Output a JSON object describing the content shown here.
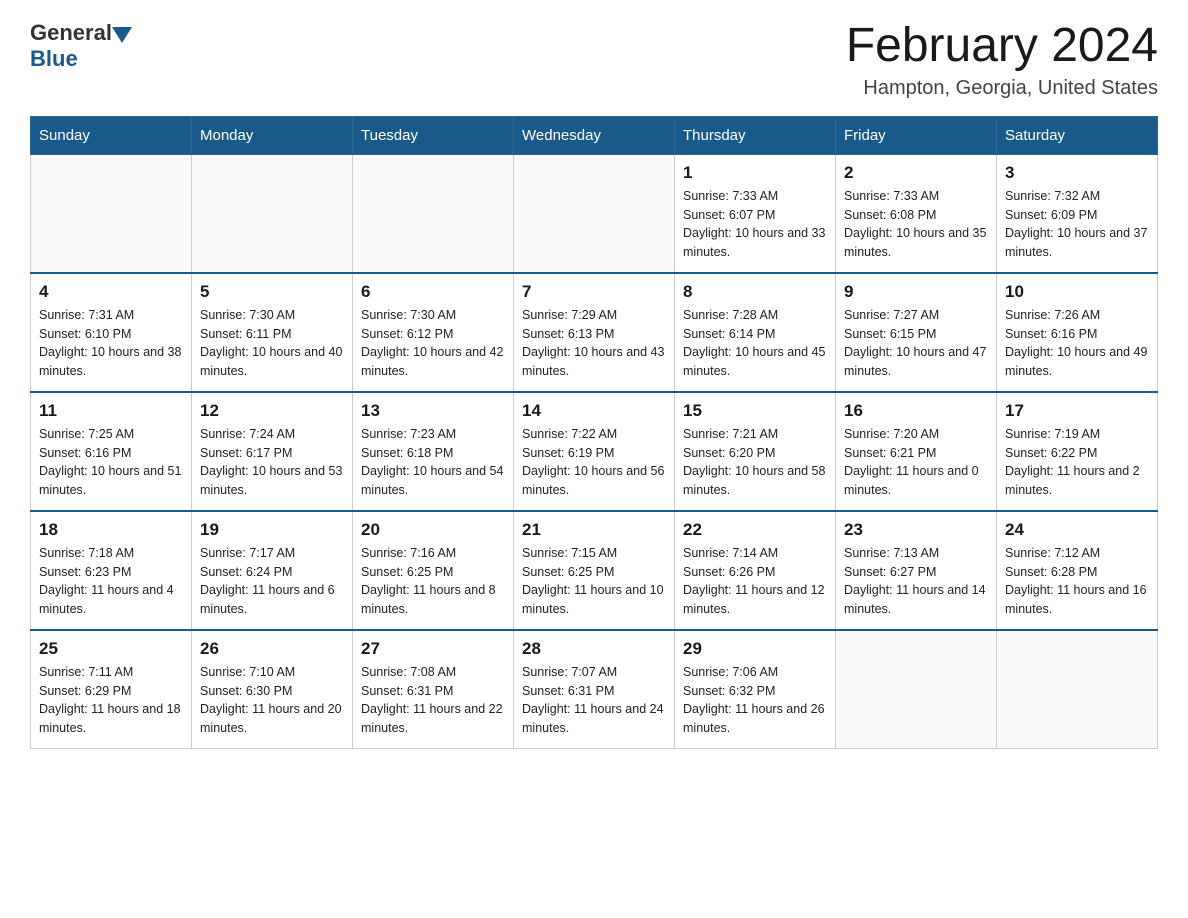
{
  "logo": {
    "text_general": "General",
    "text_blue": "Blue"
  },
  "header": {
    "month_title": "February 2024",
    "location": "Hampton, Georgia, United States"
  },
  "days_of_week": [
    "Sunday",
    "Monday",
    "Tuesday",
    "Wednesday",
    "Thursday",
    "Friday",
    "Saturday"
  ],
  "weeks": [
    [
      {
        "day": "",
        "info": ""
      },
      {
        "day": "",
        "info": ""
      },
      {
        "day": "",
        "info": ""
      },
      {
        "day": "",
        "info": ""
      },
      {
        "day": "1",
        "info": "Sunrise: 7:33 AM\nSunset: 6:07 PM\nDaylight: 10 hours and 33 minutes."
      },
      {
        "day": "2",
        "info": "Sunrise: 7:33 AM\nSunset: 6:08 PM\nDaylight: 10 hours and 35 minutes."
      },
      {
        "day": "3",
        "info": "Sunrise: 7:32 AM\nSunset: 6:09 PM\nDaylight: 10 hours and 37 minutes."
      }
    ],
    [
      {
        "day": "4",
        "info": "Sunrise: 7:31 AM\nSunset: 6:10 PM\nDaylight: 10 hours and 38 minutes."
      },
      {
        "day": "5",
        "info": "Sunrise: 7:30 AM\nSunset: 6:11 PM\nDaylight: 10 hours and 40 minutes."
      },
      {
        "day": "6",
        "info": "Sunrise: 7:30 AM\nSunset: 6:12 PM\nDaylight: 10 hours and 42 minutes."
      },
      {
        "day": "7",
        "info": "Sunrise: 7:29 AM\nSunset: 6:13 PM\nDaylight: 10 hours and 43 minutes."
      },
      {
        "day": "8",
        "info": "Sunrise: 7:28 AM\nSunset: 6:14 PM\nDaylight: 10 hours and 45 minutes."
      },
      {
        "day": "9",
        "info": "Sunrise: 7:27 AM\nSunset: 6:15 PM\nDaylight: 10 hours and 47 minutes."
      },
      {
        "day": "10",
        "info": "Sunrise: 7:26 AM\nSunset: 6:16 PM\nDaylight: 10 hours and 49 minutes."
      }
    ],
    [
      {
        "day": "11",
        "info": "Sunrise: 7:25 AM\nSunset: 6:16 PM\nDaylight: 10 hours and 51 minutes."
      },
      {
        "day": "12",
        "info": "Sunrise: 7:24 AM\nSunset: 6:17 PM\nDaylight: 10 hours and 53 minutes."
      },
      {
        "day": "13",
        "info": "Sunrise: 7:23 AM\nSunset: 6:18 PM\nDaylight: 10 hours and 54 minutes."
      },
      {
        "day": "14",
        "info": "Sunrise: 7:22 AM\nSunset: 6:19 PM\nDaylight: 10 hours and 56 minutes."
      },
      {
        "day": "15",
        "info": "Sunrise: 7:21 AM\nSunset: 6:20 PM\nDaylight: 10 hours and 58 minutes."
      },
      {
        "day": "16",
        "info": "Sunrise: 7:20 AM\nSunset: 6:21 PM\nDaylight: 11 hours and 0 minutes."
      },
      {
        "day": "17",
        "info": "Sunrise: 7:19 AM\nSunset: 6:22 PM\nDaylight: 11 hours and 2 minutes."
      }
    ],
    [
      {
        "day": "18",
        "info": "Sunrise: 7:18 AM\nSunset: 6:23 PM\nDaylight: 11 hours and 4 minutes."
      },
      {
        "day": "19",
        "info": "Sunrise: 7:17 AM\nSunset: 6:24 PM\nDaylight: 11 hours and 6 minutes."
      },
      {
        "day": "20",
        "info": "Sunrise: 7:16 AM\nSunset: 6:25 PM\nDaylight: 11 hours and 8 minutes."
      },
      {
        "day": "21",
        "info": "Sunrise: 7:15 AM\nSunset: 6:25 PM\nDaylight: 11 hours and 10 minutes."
      },
      {
        "day": "22",
        "info": "Sunrise: 7:14 AM\nSunset: 6:26 PM\nDaylight: 11 hours and 12 minutes."
      },
      {
        "day": "23",
        "info": "Sunrise: 7:13 AM\nSunset: 6:27 PM\nDaylight: 11 hours and 14 minutes."
      },
      {
        "day": "24",
        "info": "Sunrise: 7:12 AM\nSunset: 6:28 PM\nDaylight: 11 hours and 16 minutes."
      }
    ],
    [
      {
        "day": "25",
        "info": "Sunrise: 7:11 AM\nSunset: 6:29 PM\nDaylight: 11 hours and 18 minutes."
      },
      {
        "day": "26",
        "info": "Sunrise: 7:10 AM\nSunset: 6:30 PM\nDaylight: 11 hours and 20 minutes."
      },
      {
        "day": "27",
        "info": "Sunrise: 7:08 AM\nSunset: 6:31 PM\nDaylight: 11 hours and 22 minutes."
      },
      {
        "day": "28",
        "info": "Sunrise: 7:07 AM\nSunset: 6:31 PM\nDaylight: 11 hours and 24 minutes."
      },
      {
        "day": "29",
        "info": "Sunrise: 7:06 AM\nSunset: 6:32 PM\nDaylight: 11 hours and 26 minutes."
      },
      {
        "day": "",
        "info": ""
      },
      {
        "day": "",
        "info": ""
      }
    ]
  ]
}
